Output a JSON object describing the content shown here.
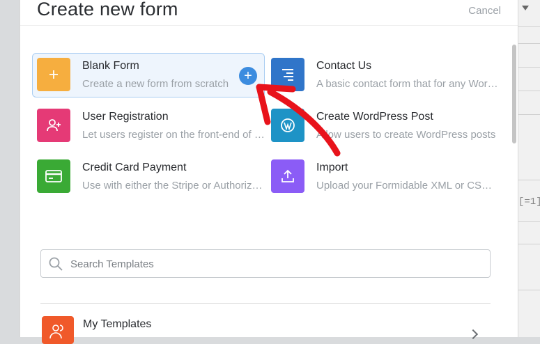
{
  "modal": {
    "title": "Create new form",
    "cancel_label": "Cancel"
  },
  "options": [
    {
      "name": "Blank Form",
      "desc": "Create a new form from scratch",
      "color": "#f6ae3f",
      "icon": "plus-icon",
      "selected": true
    },
    {
      "name": "Contact Us",
      "desc": "A basic contact form that for any WordPress site",
      "color": "#3075c9",
      "icon": "align-right-lines-icon"
    },
    {
      "name": "User Registration",
      "desc": "Let users register on the front-end of your site",
      "color": "#e53a76",
      "icon": "add-user-icon"
    },
    {
      "name": "Create WordPress Post",
      "desc": "Allow users to create WordPress posts",
      "color": "#1e93c6",
      "icon": "wordpress-icon"
    },
    {
      "name": "Credit Card Payment",
      "desc": "Use with either the Stripe or Authorize.net add-on",
      "color": "#3aaa35",
      "icon": "credit-card-icon"
    },
    {
      "name": "Import",
      "desc": "Upload your Formidable XML or CSV file",
      "color": "#8b5cf6",
      "icon": "upload-icon"
    }
  ],
  "blank_form_add_label": "+",
  "search": {
    "placeholder": "Search Templates",
    "value": ""
  },
  "my_templates": {
    "label": "My Templates",
    "color": "#f0592a",
    "icon": "users-icon"
  },
  "background": {
    "code_text": "[=1]"
  },
  "annotation": {
    "arrow_color": "#e8131b"
  }
}
